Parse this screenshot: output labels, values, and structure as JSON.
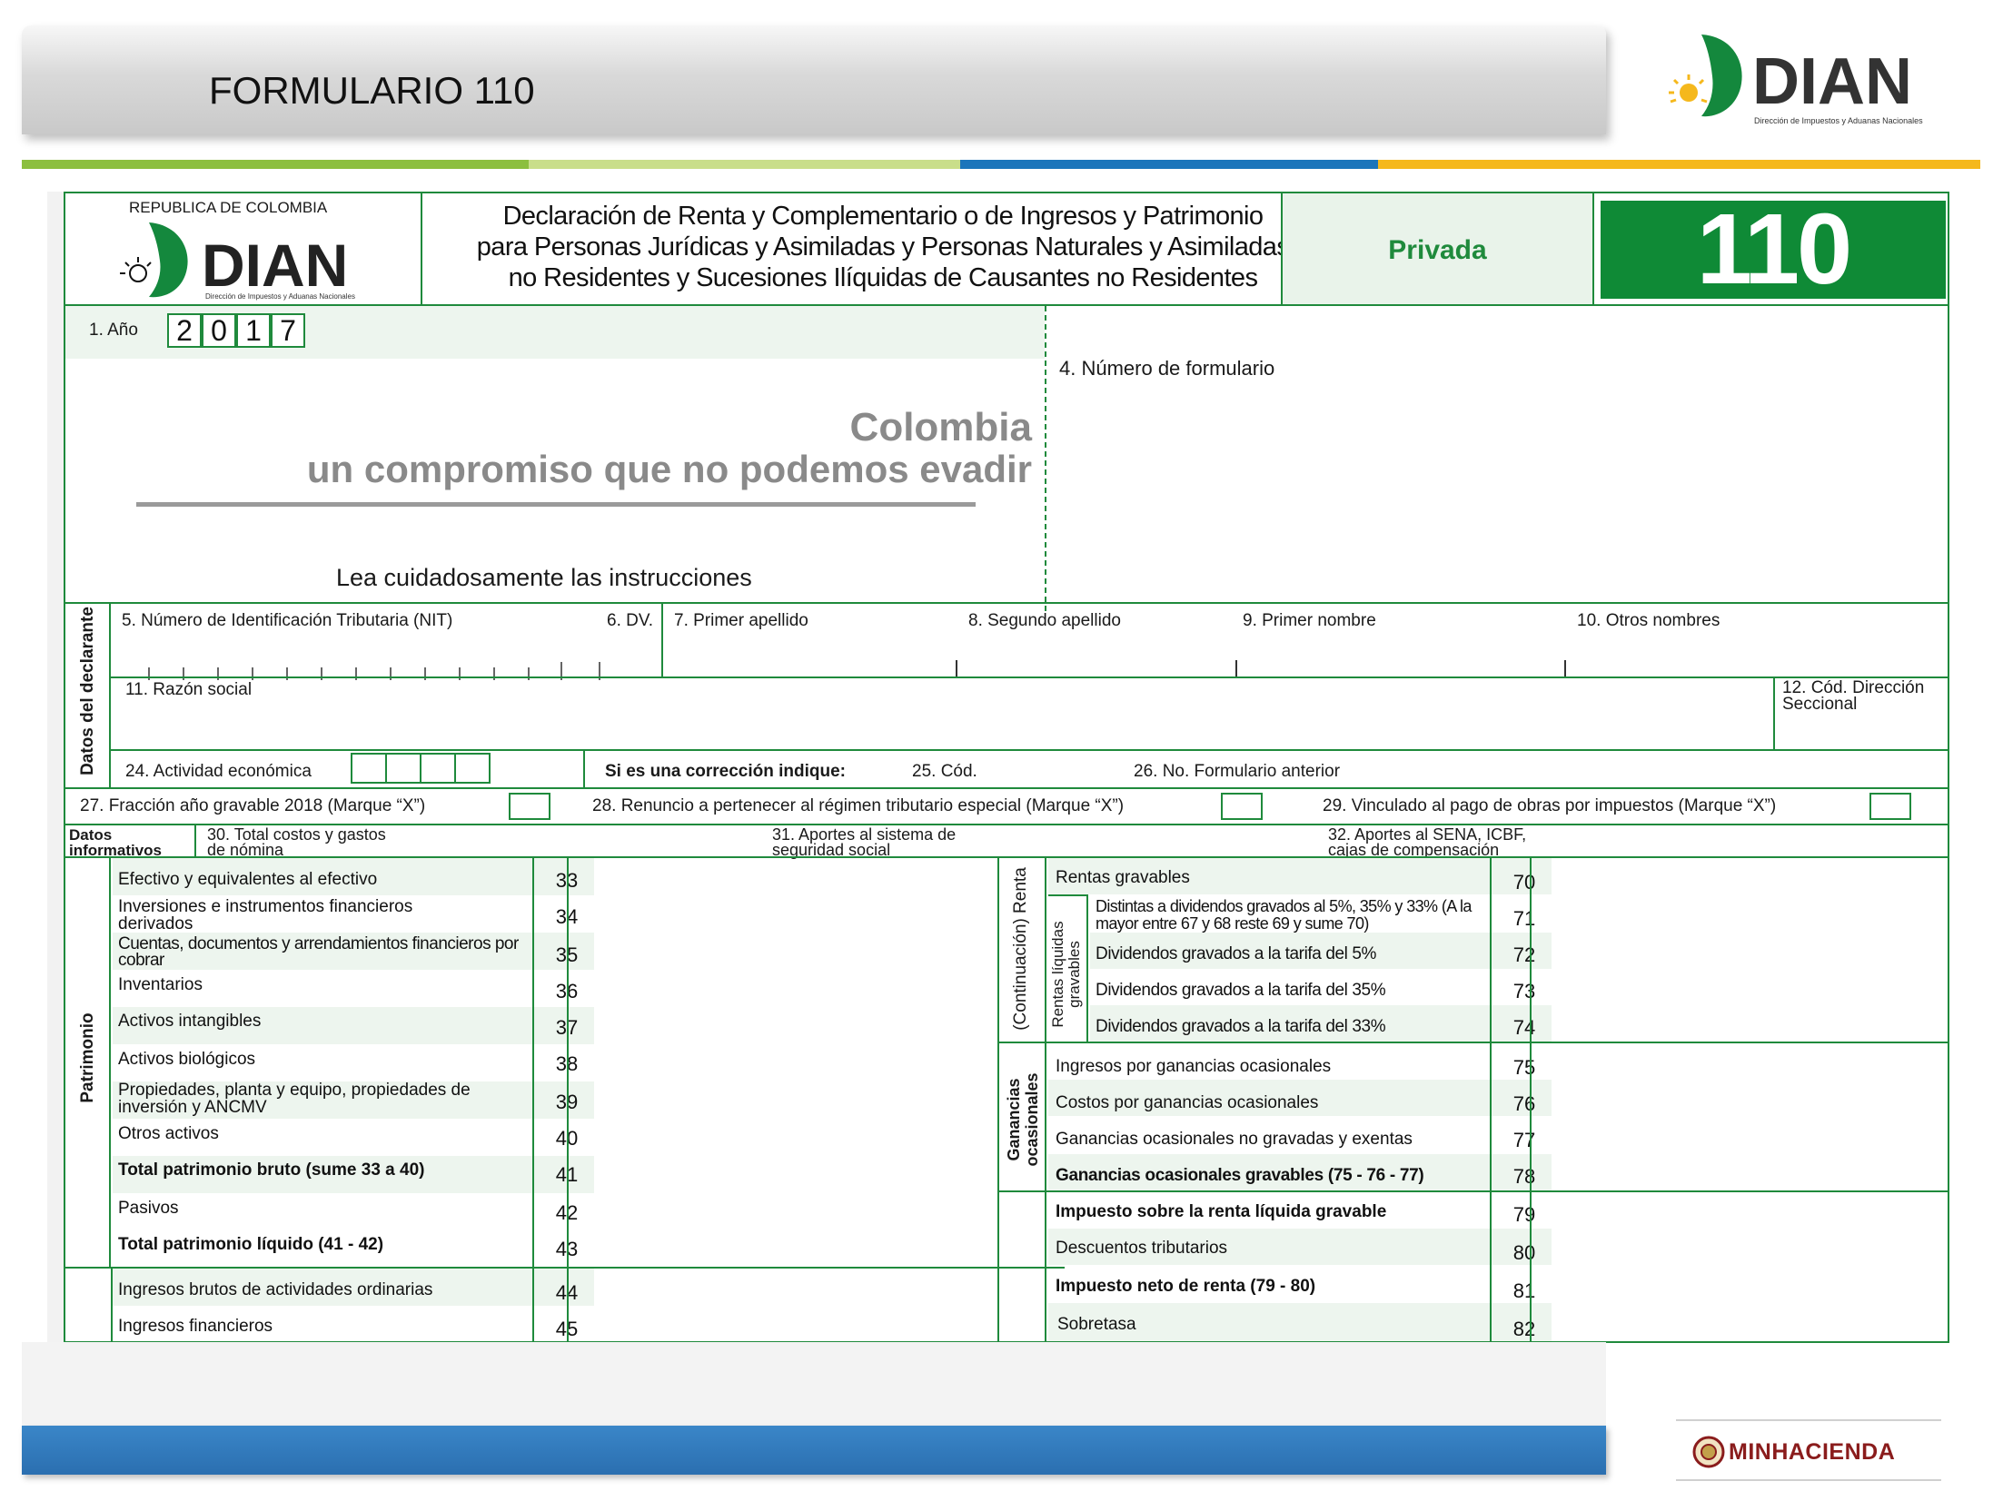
{
  "slide": {
    "title": "FORMULARIO 110",
    "footer_brand": "MINHACIENDA",
    "stripe_colors": [
      "#8cbf3f",
      "#c9de8a",
      "#1b75bb",
      "#f5b81c"
    ]
  },
  "top_logo": {
    "name": "DIAN",
    "subtitle": "Dirección de Impuestos y Aduanas Nacionales"
  },
  "form": {
    "republica": "REPUBLICA DE COLOMBIA",
    "logo_name": "DIAN",
    "logo_subtitle": "Dirección de Impuestos y Aduanas Nacionales",
    "title_lines": [
      "Declaración de Renta y Complementario o de Ingresos y Patrimonio",
      "para Personas Jurídicas y Asimiladas y Personas Naturales y Asimiladas",
      "no Residentes y Sucesiones Ilíquidas de Causantes no Residentes"
    ],
    "privada": "Privada",
    "number": "110",
    "year_label": "1. Año",
    "year_digits": [
      "2",
      "0",
      "1",
      "7"
    ],
    "form_number_label": "4. Número de formulario",
    "slogan_line1": "Colombia",
    "slogan_line2": "un compromiso que no podemos evadir",
    "instructions": "Lea cuidadosamente las instrucciones",
    "declarante_section": "Datos del declarante",
    "fields": {
      "nit": "5. Número de Identificación Tributaria (NIT)",
      "dv": "6. DV.",
      "primer_apellido": "7. Primer apellido",
      "segundo_apellido": "8. Segundo apellido",
      "primer_nombre": "9. Primer nombre",
      "otros_nombres": "10. Otros nombres",
      "razon_social": "11. Razón social",
      "cod_direccion": "12. Cód. Dirección Seccional",
      "actividad": "24. Actividad económica",
      "correccion": "Si es una corrección indique:",
      "cod": "25. Cód.",
      "form_anterior": "26. No. Formulario anterior",
      "fraccion": "27. Fracción año gravable 2018 (Marque “X”)",
      "renuncio": "28. Renuncio a pertenecer al régimen tributario especial (Marque “X”)",
      "vinculado": "29. Vinculado al pago de obras por impuestos (Marque “X”)",
      "datos_informativos": "Datos informativos",
      "costos_nomina": "30. Total costos y gastos de nómina",
      "aportes_seguridad": "31. Aportes al sistema de seguridad social",
      "aportes_sena": "32. Aportes al SENA, ICBF, cajas de compensación"
    },
    "patrimonio_section": "Patrimonio",
    "patrimonio_rows": [
      {
        "label": "Efectivo y equivalentes al efectivo",
        "num": "33"
      },
      {
        "label": "Inversiones e instrumentos financieros derivados",
        "num": "34"
      },
      {
        "label": "Cuentas, documentos y arrendamientos financieros por cobrar",
        "num": "35"
      },
      {
        "label": "Inventarios",
        "num": "36"
      },
      {
        "label": "Activos intangibles",
        "num": "37"
      },
      {
        "label": "Activos biológicos",
        "num": "38"
      },
      {
        "label": "Propiedades, planta y equipo, propiedades de inversión y  ANCMV",
        "num": "39"
      },
      {
        "label": "Otros activos",
        "num": "40"
      },
      {
        "label": "Total patrimonio bruto (sume 33 a 40)",
        "num": "41"
      },
      {
        "label": "Pasivos",
        "num": "42"
      },
      {
        "label": "Total patrimonio líquido (41 - 42)",
        "num": "43"
      }
    ],
    "ingresos_rows": [
      {
        "label": "Ingresos brutos de actividades ordinarias",
        "num": "44"
      },
      {
        "label": "Ingresos financieros",
        "num": "45"
      }
    ],
    "renta_section": "(Continuación) Renta",
    "rentas_liquidas_section": "Rentas líquidas gravables",
    "renta_rows": [
      {
        "label": "Rentas gravables",
        "num": "70"
      },
      {
        "label": "Distintas a dividendos gravados al 5%, 35% y 33% (A la mayor entre 67 y 68 reste 69 y sume 70)",
        "num": "71"
      },
      {
        "label": "Dividendos gravados a la tarifa del 5%",
        "num": "72"
      },
      {
        "label": "Dividendos gravados a la tarifa del 35%",
        "num": "73"
      },
      {
        "label": "Dividendos gravados a la tarifa del 33%",
        "num": "74"
      }
    ],
    "ganancias_section": "Ganancias ocasionales",
    "ganancias_rows": [
      {
        "label": "Ingresos por ganancias ocasionales",
        "num": "75"
      },
      {
        "label": "Costos por ganancias ocasionales",
        "num": "76"
      },
      {
        "label": "Ganancias ocasionales no gravadas y exentas",
        "num": "77"
      },
      {
        "label": "Ganancias ocasionales gravables (75 - 76 - 77)",
        "num": "78"
      }
    ],
    "impuesto_rows": [
      {
        "label": "Impuesto sobre la renta líquida gravable",
        "num": "79"
      },
      {
        "label": "Descuentos tributarios",
        "num": "80"
      },
      {
        "label": "Impuesto neto de renta (79 - 80)",
        "num": "81"
      },
      {
        "label": "Sobretasa",
        "num": "82"
      }
    ]
  }
}
